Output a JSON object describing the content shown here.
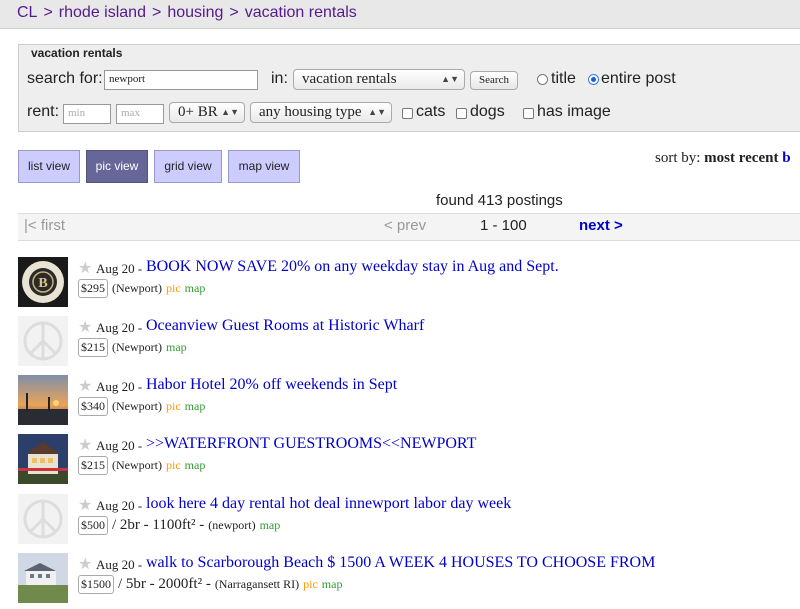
{
  "breadcrumb": {
    "items": [
      "CL",
      "rhode island",
      "housing",
      "vacation rentals"
    ],
    "separator": ">"
  },
  "search": {
    "legend": "vacation rentals",
    "search_for_label": "search for:",
    "query_value": "newport",
    "in_label": "in:",
    "category_selected": "vacation rentals",
    "search_button": "Search",
    "title_option": "title",
    "entire_post_option": "entire post",
    "selected_scope": "entire post",
    "rent_label": "rent:",
    "min_placeholder": "min",
    "max_placeholder": "max",
    "bedrooms_selected": "0+ BR",
    "housing_type_selected": "any housing type",
    "cats_label": "cats",
    "dogs_label": "dogs",
    "has_image_label": "has image"
  },
  "views": {
    "list": "list view",
    "pic": "pic view",
    "grid": "grid view",
    "map": "map view",
    "active": "pic view"
  },
  "sort": {
    "label": "sort by:",
    "current": "most recent",
    "next_option_partial": "b"
  },
  "results": {
    "found_text": "found 413 postings"
  },
  "pagination": {
    "first": "|< first",
    "prev": "< prev",
    "range": "1 - 100",
    "next": "next >"
  },
  "colors": {
    "link_blue": "#0000cc",
    "visited_purple": "#551a8b",
    "pic_tag": "#ff9900",
    "map_tag": "#339933",
    "active_view": "#666699",
    "view_button": "#ccccff"
  },
  "listings": [
    {
      "date": "Aug 20",
      "dash": "-",
      "title": "BOOK NOW SAVE 20% on any weekday stay in Aug and Sept.",
      "price": "$295",
      "extra": "",
      "location": "(Newport)",
      "pic": "pic",
      "map": "map",
      "thumb": "hotel-seal-logo"
    },
    {
      "date": "Aug 20",
      "dash": "-",
      "title": "Oceanview Guest Rooms at Historic Wharf",
      "price": "$215",
      "extra": "",
      "location": "(Newport)",
      "pic": "",
      "map": "map",
      "thumb": "peace-placeholder"
    },
    {
      "date": "Aug 20",
      "dash": "-",
      "title": "Habor Hotel 20% off weekends in Sept",
      "price": "$340",
      "extra": "",
      "location": "(Newport)",
      "pic": "pic",
      "map": "map",
      "thumb": "harbor-sunset-photo"
    },
    {
      "date": "Aug 20",
      "dash": "-",
      "title": ">>WATERFRONT GUESTROOMS<<NEWPORT",
      "price": "$215",
      "extra": "",
      "location": "(Newport)",
      "pic": "pic",
      "map": "map",
      "thumb": "house-photo"
    },
    {
      "date": "Aug 20",
      "dash": "-",
      "title": "look here 4 day rental hot deal innewport labor day week",
      "price": "$500",
      "extra": "/ 2br - 1100ft² -",
      "location": "(newport)",
      "pic": "",
      "map": "map",
      "thumb": "peace-placeholder"
    },
    {
      "date": "Aug 20",
      "dash": "-",
      "title": "walk to Scarborough Beach $ 1500 A WEEK 4 HOUSES TO CHOOSE FROM",
      "price": "$1500",
      "extra": "/ 5br - 2000ft² -",
      "location": "(Narragansett RI)",
      "pic": "pic",
      "map": "map",
      "thumb": "beach-house-photo"
    }
  ]
}
